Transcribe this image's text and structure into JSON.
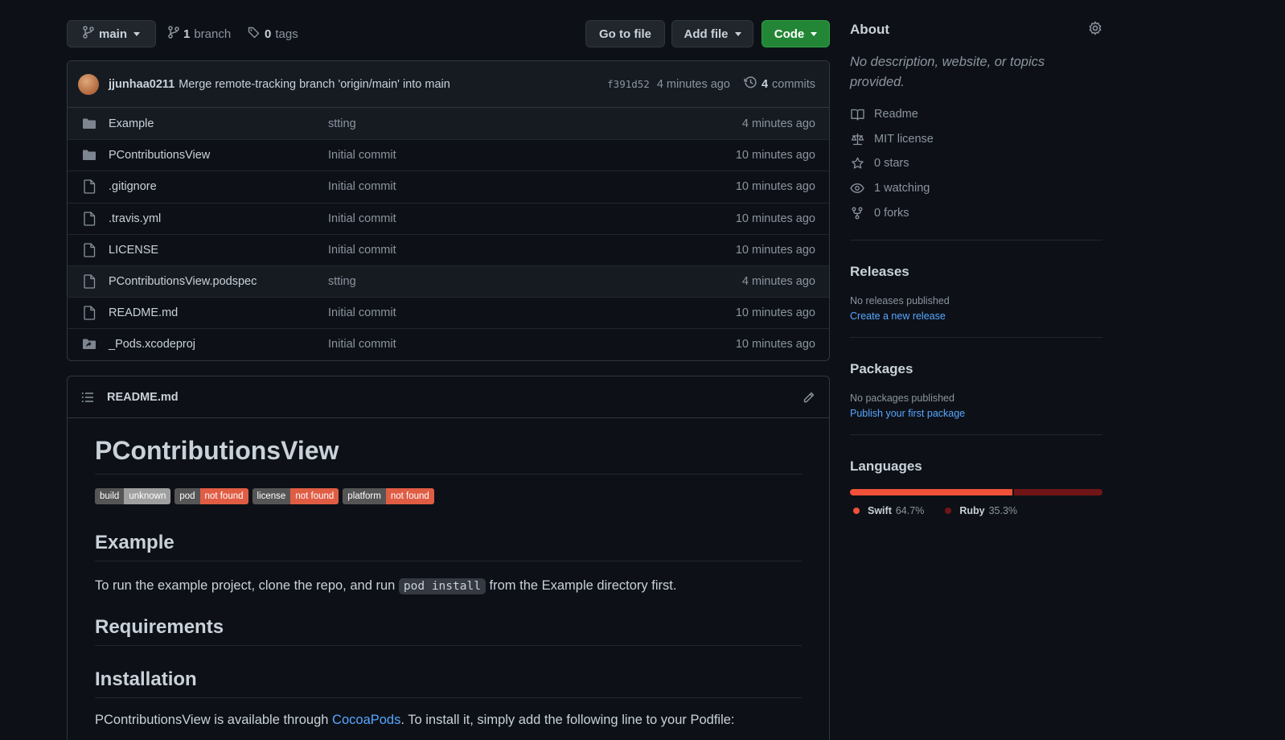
{
  "branch": {
    "name": "main",
    "branch_count": "1",
    "branch_label": "branch",
    "tag_count": "0",
    "tag_label": "tags"
  },
  "toolbar": {
    "go_to_file": "Go to file",
    "add_file": "Add file",
    "code": "Code"
  },
  "latest_commit": {
    "author": "jjunhaa0211",
    "message": "Merge remote-tracking branch 'origin/main' into main",
    "sha": "f391d52",
    "age": "4 minutes ago",
    "commit_count": "4",
    "commits_label": "commits"
  },
  "files": [
    {
      "name": "Example",
      "type": "folder",
      "message": "stting",
      "age": "4 minutes ago"
    },
    {
      "name": "PContributionsView",
      "type": "folder",
      "message": "Initial commit",
      "age": "10 minutes ago"
    },
    {
      "name": ".gitignore",
      "type": "file",
      "message": "Initial commit",
      "age": "10 minutes ago"
    },
    {
      "name": ".travis.yml",
      "type": "file",
      "message": "Initial commit",
      "age": "10 minutes ago"
    },
    {
      "name": "LICENSE",
      "type": "file",
      "message": "Initial commit",
      "age": "10 minutes ago"
    },
    {
      "name": "PContributionsView.podspec",
      "type": "file",
      "message": "stting",
      "age": "4 minutes ago"
    },
    {
      "name": "README.md",
      "type": "file",
      "message": "Initial commit",
      "age": "10 minutes ago"
    },
    {
      "name": "_Pods.xcodeproj",
      "type": "symlink-folder",
      "message": "Initial commit",
      "age": "10 minutes ago"
    }
  ],
  "readme": {
    "filename": "README.md",
    "title": "PContributionsView",
    "badges": [
      {
        "key": "build",
        "value": "unknown",
        "color": "#9f9f9f"
      },
      {
        "key": "pod",
        "value": "not found",
        "color": "#e05d44"
      },
      {
        "key": "license",
        "value": "not found",
        "color": "#e05d44"
      },
      {
        "key": "platform",
        "value": "not found",
        "color": "#e05d44"
      }
    ],
    "example_heading": "Example",
    "example_text_before": "To run the example project, clone the repo, and run ",
    "example_code": "pod install",
    "example_text_after": " from the Example directory first.",
    "requirements_heading": "Requirements",
    "installation_heading": "Installation",
    "install_text_before": "PContributionsView is available through ",
    "install_link": "CocoaPods",
    "install_text_after": ". To install it, simply add the following line to your Podfile:"
  },
  "about": {
    "title": "About",
    "description": "No description, website, or topics provided.",
    "items": [
      {
        "icon": "book-icon",
        "label": "Readme"
      },
      {
        "icon": "scale-icon",
        "label": "MIT license"
      },
      {
        "icon": "star-icon",
        "label": "0 stars"
      },
      {
        "icon": "eye-icon",
        "label": "1 watching"
      },
      {
        "icon": "fork-icon",
        "label": "0 forks"
      }
    ]
  },
  "releases": {
    "title": "Releases",
    "empty_text": "No releases published",
    "link": "Create a new release"
  },
  "packages": {
    "title": "Packages",
    "empty_text": "No packages published",
    "link": "Publish your first package"
  },
  "languages": {
    "title": "Languages",
    "items": [
      {
        "name": "Swift",
        "percent": "64.7%",
        "value": 64.7,
        "color": "#f05138"
      },
      {
        "name": "Ruby",
        "percent": "35.3%",
        "value": 35.3,
        "color": "#701516"
      }
    ]
  },
  "colors": {
    "accent_green": "#238636",
    "link_blue": "#58a6ff",
    "background": "#0d1117"
  }
}
